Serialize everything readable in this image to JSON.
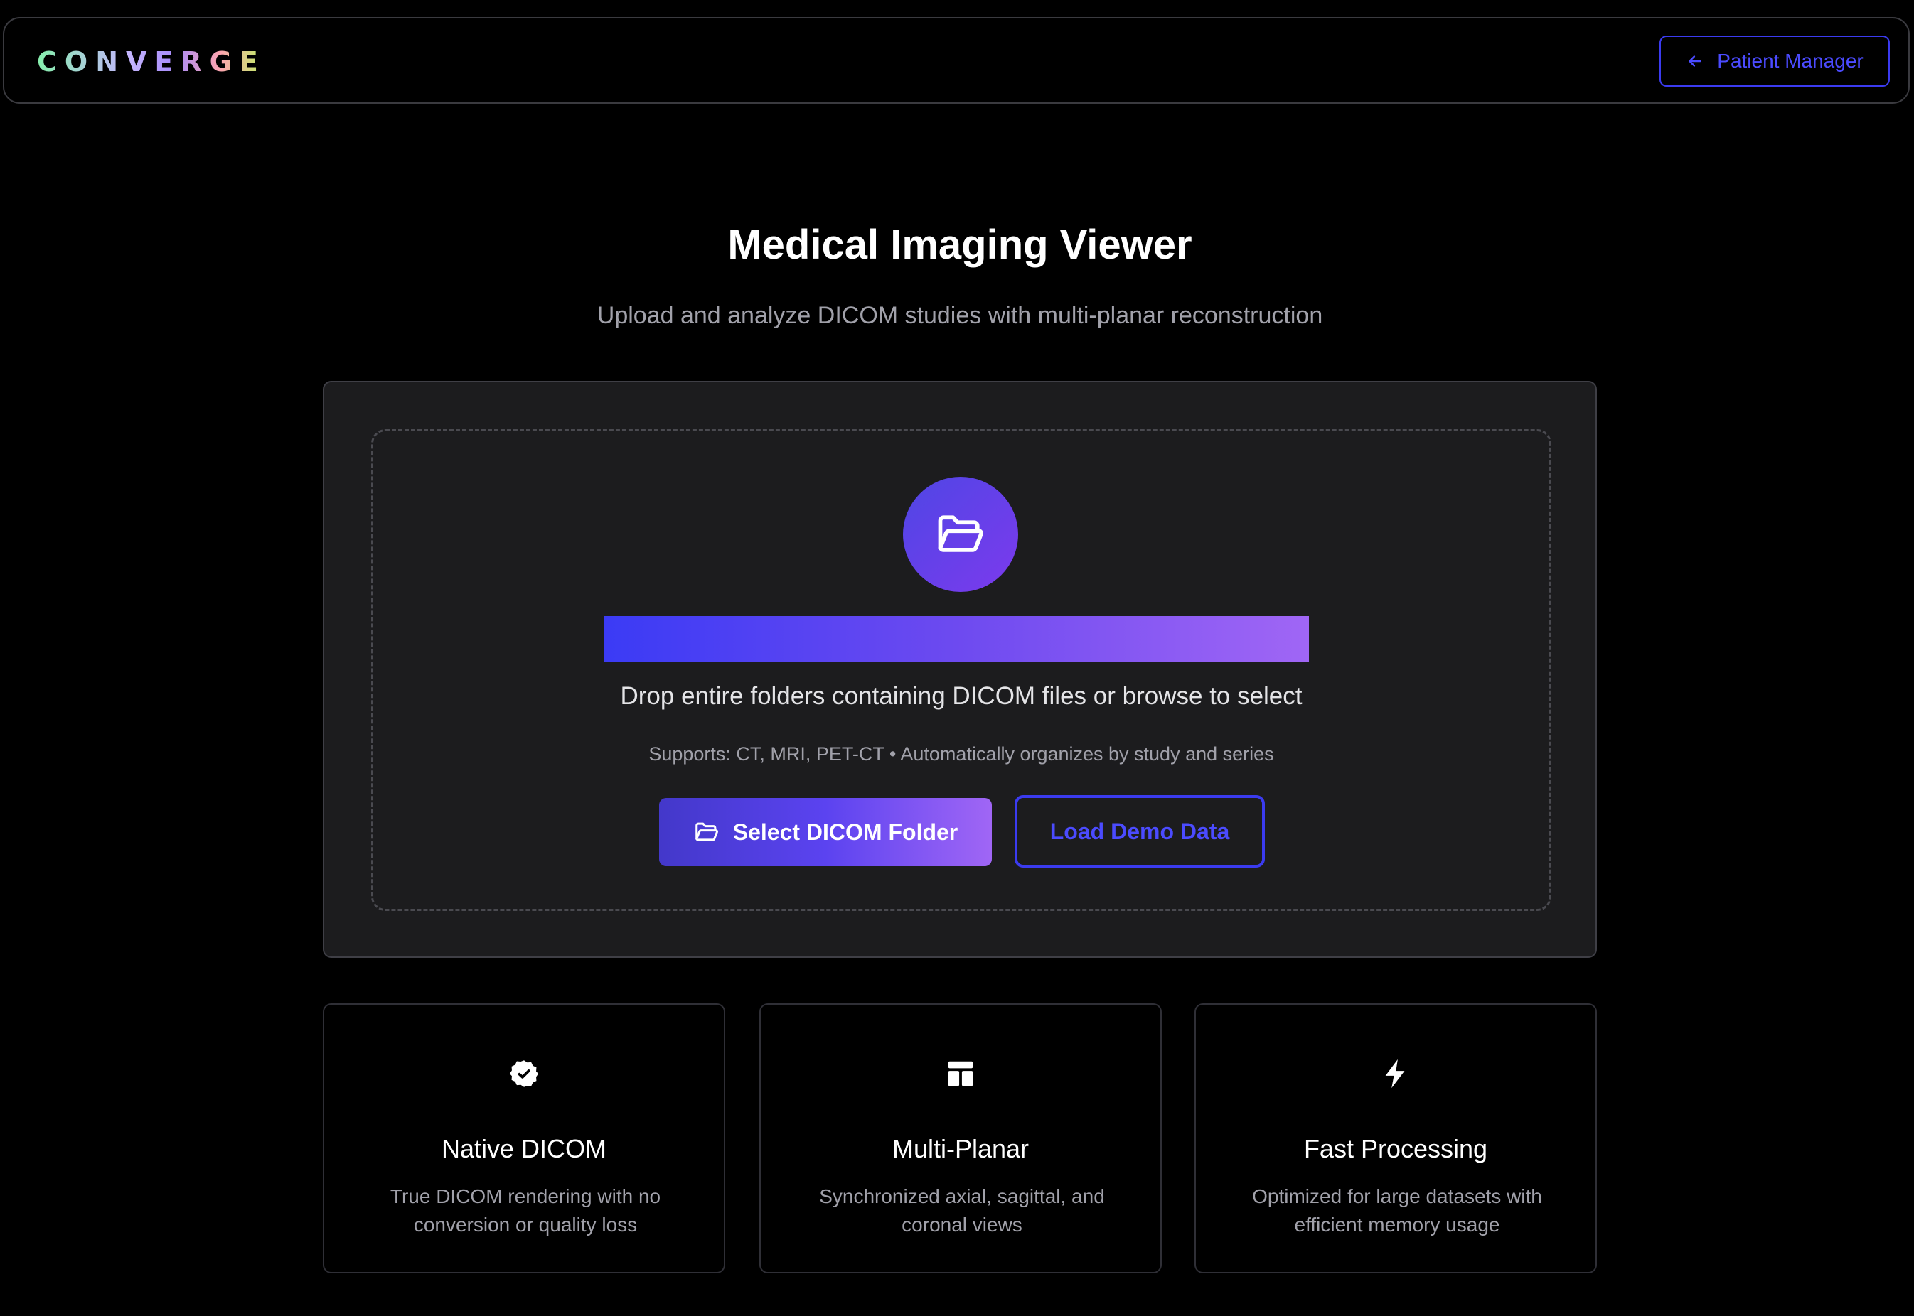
{
  "header": {
    "logo": "CONVERGE",
    "patient_manager_label": "Patient Manager"
  },
  "main": {
    "title": "Medical Imaging Viewer",
    "subtitle": "Upload and analyze DICOM studies with multi-planar reconstruction"
  },
  "upload": {
    "drop_text": "Drop entire folders containing DICOM files or browse to select",
    "supports_text": "Supports: CT, MRI, PET-CT • Automatically organizes by study and series",
    "select_button_label": "Select DICOM Folder",
    "demo_button_label": "Load Demo Data"
  },
  "features": [
    {
      "icon": "check-badge-icon",
      "title": "Native DICOM",
      "description": "True DICOM rendering with no conversion or quality loss"
    },
    {
      "icon": "layout-icon",
      "title": "Multi-Planar",
      "description": "Synchronized axial, sagittal, and coronal views"
    },
    {
      "icon": "lightning-icon",
      "title": "Fast Processing",
      "description": "Optimized for large datasets with efficient memory usage"
    }
  ],
  "colors": {
    "background": "#000000",
    "panel": "#1c1c1e",
    "accent_blue": "#3b3bf0",
    "accent_purple": "#a066f5",
    "muted_text": "#a1a1aa"
  }
}
